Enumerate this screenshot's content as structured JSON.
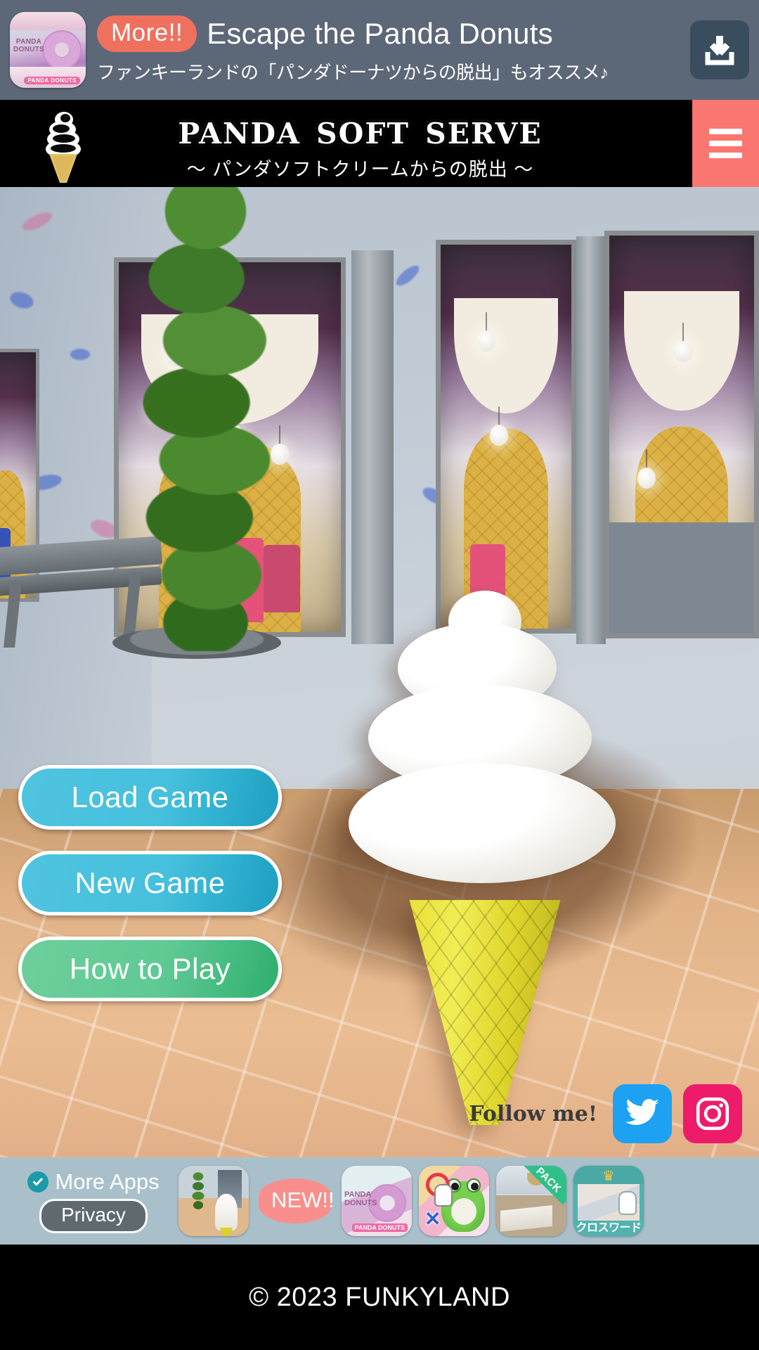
{
  "ad_banner": {
    "badge": "More!!",
    "title": "Escape the Panda Donuts",
    "subtitle": "ファンキーランドの「パンダドーナツからの脱出」もオススメ♪",
    "thumb_label": "PANDA\nDONUTS",
    "thumb_tag": "DONUTS",
    "download_icon": "download-icon",
    "bg_color": "#5c6777",
    "badge_color": "#f0705e",
    "download_color": "#3a4d5e"
  },
  "title_bar": {
    "logo_icon": "soft-serve-cone-icon",
    "title": "Panda Soft Serve",
    "subtitle": "〜 パンダソフトクリームからの脱出 〜",
    "menu_icon": "hamburger-menu-icon",
    "menu_color": "#fa7670",
    "bg_color": "#000000"
  },
  "menu": {
    "buttons": [
      {
        "label": "Load Game",
        "color": "#46c0dd",
        "style": "blue"
      },
      {
        "label": "New Game",
        "color": "#46c0dd",
        "style": "blue"
      },
      {
        "label": "How to Play",
        "color": "#5fc994",
        "style": "green"
      }
    ]
  },
  "social": {
    "label": "Follow me!",
    "items": [
      {
        "name": "twitter-icon",
        "color": "#1da1f2"
      },
      {
        "name": "instagram-icon",
        "color": "#ee1b6a"
      }
    ]
  },
  "apps_bar": {
    "bg_color": "#a9c0cb",
    "more_apps_label": "More Apps",
    "check_icon": "check-badge-icon",
    "check_color": "#1b9aaa",
    "privacy_label": "Privacy",
    "new_badge": "NEW!!",
    "new_badge_color": "#f98f8c",
    "icons": [
      {
        "name": "app-icon-panda-soft-serve",
        "caption": ""
      },
      {
        "name": "app-icon-panda-donuts",
        "caption": "PANDA DONUTS"
      },
      {
        "name": "app-icon-frog",
        "caption": ""
      },
      {
        "name": "app-icon-room-pack",
        "caption": "PACK"
      },
      {
        "name": "app-icon-crossword",
        "caption": "クロスワード"
      }
    ]
  },
  "footer": {
    "copyright": "© 2023 FUNKYLAND"
  }
}
